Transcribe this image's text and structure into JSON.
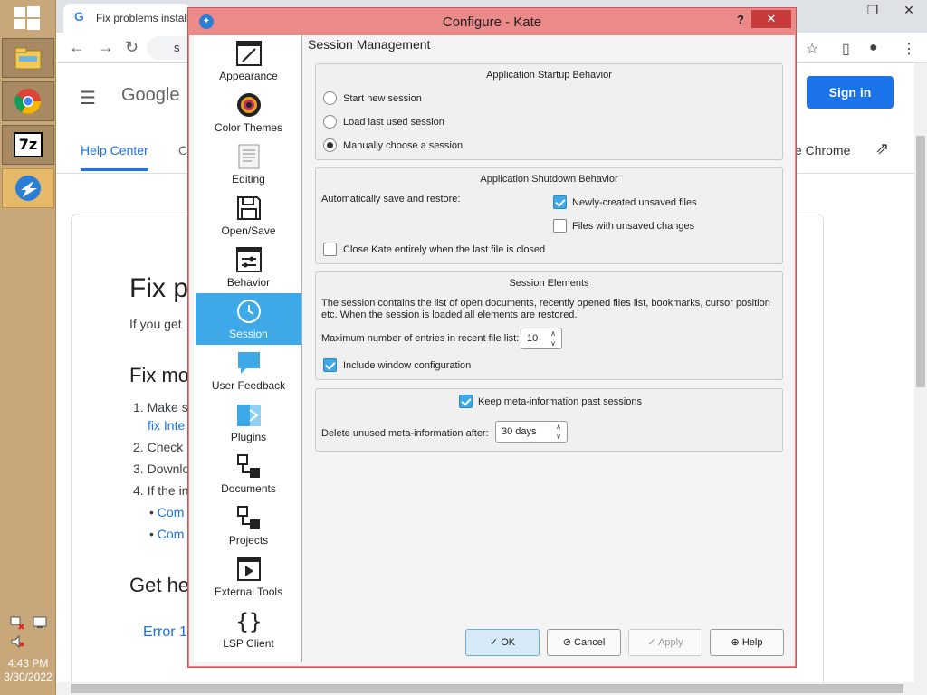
{
  "taskbar": {
    "apps": [
      "Explorer",
      "Chrome",
      "7-Zip",
      "Kate"
    ],
    "app_7z_label": "7z",
    "time": "4:43 PM",
    "date": "3/30/2022"
  },
  "browser": {
    "tab_title": "Fix problems install",
    "url": "s",
    "google_logo": "Google",
    "sign_in": "Sign in",
    "help_center": "Help Center",
    "nav_partial": "C",
    "google_chrome_partial": "gle Chrome",
    "article_title": "Fix p",
    "article_sub": "If you get",
    "section_title": "Fix mo",
    "list": [
      {
        "num": "1.",
        "text": "Make s"
      },
      {
        "num": "",
        "text": "fix Inte",
        "link": true
      },
      {
        "num": "2.",
        "text": "Check"
      },
      {
        "num": "3.",
        "text": "Downlo"
      },
      {
        "num": "4.",
        "text": "If the in"
      },
      {
        "num": "•",
        "text": "Com",
        "link": true
      },
      {
        "num": "•",
        "text": "Com",
        "link": true
      }
    ],
    "get_help": "Get he",
    "error_link": "Error 1"
  },
  "dialog": {
    "title": "Configure - Kate",
    "help_glyph": "?",
    "close_glyph": "✕",
    "sidebar": [
      {
        "label": "Appearance",
        "icon": "appearance-icon"
      },
      {
        "label": "Color Themes",
        "icon": "color-themes-icon"
      },
      {
        "label": "Editing",
        "icon": "editing-icon"
      },
      {
        "label": "Open/Save",
        "icon": "open-save-icon"
      },
      {
        "label": "Behavior",
        "icon": "behavior-icon"
      },
      {
        "label": "Session",
        "icon": "session-icon",
        "selected": true
      },
      {
        "label": "User Feedback",
        "icon": "user-feedback-icon"
      },
      {
        "label": "Plugins",
        "icon": "plugins-icon"
      },
      {
        "label": "Documents",
        "icon": "documents-icon"
      },
      {
        "label": "Projects",
        "icon": "projects-icon"
      },
      {
        "label": "External Tools",
        "icon": "external-tools-icon"
      },
      {
        "label": "LSP Client",
        "icon": "lsp-client-icon"
      }
    ],
    "section_title": "Session Management",
    "startup": {
      "title": "Application Startup Behavior",
      "options": [
        {
          "label": "Start new session",
          "checked": false
        },
        {
          "label": "Load last used session",
          "checked": false
        },
        {
          "label": "Manually choose a session",
          "checked": true
        }
      ]
    },
    "shutdown": {
      "title": "Application Shutdown Behavior",
      "auto_label": "Automatically save and restore:",
      "newly_created": {
        "label": "Newly-created unsaved files",
        "checked": true
      },
      "unsaved_changes": {
        "label": "Files with unsaved changes",
        "checked": false
      },
      "close_kate": {
        "label": "Close Kate entirely when the last file is closed",
        "checked": false
      }
    },
    "elements": {
      "title": "Session Elements",
      "description_1": "The session contains the list of open documents, recently opened files list, bookmarks, cursor position",
      "description_2": "etc. When the session is loaded all elements are restored.",
      "max_entries_label": "Maximum number of entries in recent file list:",
      "max_entries_value": "10",
      "include_window": {
        "label": "Include window configuration",
        "checked": true
      }
    },
    "meta": {
      "keep": {
        "label": "Keep meta-information past sessions",
        "checked": true
      },
      "delete_label": "Delete unused meta-information after:",
      "delete_value": "30 days"
    },
    "buttons": {
      "ok": "OK",
      "cancel": "Cancel",
      "apply": "Apply",
      "help": "Help"
    }
  }
}
